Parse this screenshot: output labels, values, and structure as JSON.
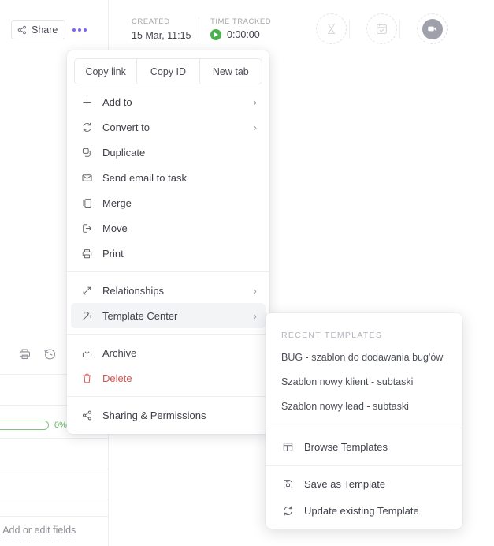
{
  "topbar": {
    "share_label": "Share",
    "share_icon": "share-nodes-icon",
    "more_icon": "ellipsis-icon",
    "created_label": "CREATED",
    "created_value": "15 Mar, 11:15",
    "time_tracked_label": "TIME TRACKED",
    "time_tracked_value": "0:00:00",
    "play_icon": "play-circle-icon",
    "buttons": [
      {
        "name": "hourglass-icon",
        "title": "Track time estimate"
      },
      {
        "name": "calendar-check-icon",
        "title": "Set due date"
      },
      {
        "name": "video-camera-icon",
        "title": "Record clip"
      }
    ]
  },
  "left_panel": {
    "print_icon": "print-icon",
    "history_icon": "history-clock-icon",
    "progress_percent": "0%",
    "progress_value": 0,
    "add_fields_plus": "+",
    "add_fields_label": "Add or edit fields"
  },
  "context_menu": {
    "quick_actions": [
      {
        "label": "Copy link",
        "name": "copy-link-button"
      },
      {
        "label": "Copy ID",
        "name": "copy-id-button"
      },
      {
        "label": "New tab",
        "name": "new-tab-button"
      }
    ],
    "group_one": [
      {
        "label": "Add to",
        "icon": "plus-icon",
        "arrow": "›",
        "name": "menu-item-add-to"
      },
      {
        "label": "Convert to",
        "icon": "convert-arrows-icon",
        "arrow": "›",
        "name": "menu-item-convert-to"
      },
      {
        "label": "Duplicate",
        "icon": "duplicate-icon",
        "arrow": "",
        "name": "menu-item-duplicate"
      },
      {
        "label": "Send email to task",
        "icon": "envelope-icon",
        "arrow": "",
        "name": "menu-item-send-email-to-task"
      },
      {
        "label": "Merge",
        "icon": "merge-icon",
        "arrow": "",
        "name": "menu-item-merge"
      },
      {
        "label": "Move",
        "icon": "move-arrow-icon",
        "arrow": "",
        "name": "menu-item-move"
      },
      {
        "label": "Print",
        "icon": "print-icon",
        "arrow": "",
        "name": "menu-item-print"
      }
    ],
    "group_two": [
      {
        "label": "Relationships",
        "icon": "relationships-icon",
        "arrow": "›",
        "name": "menu-item-relationships",
        "active": false
      },
      {
        "label": "Template Center",
        "icon": "magic-wand-icon",
        "arrow": "›",
        "name": "menu-item-template-center",
        "active": true
      }
    ],
    "group_three": [
      {
        "label": "Archive",
        "icon": "archive-box-icon",
        "arrow": "",
        "name": "menu-item-archive",
        "danger": false
      },
      {
        "label": "Delete",
        "icon": "trash-icon",
        "arrow": "",
        "name": "menu-item-delete",
        "danger": true
      }
    ],
    "group_four": [
      {
        "label": "Sharing & Permissions",
        "icon": "share-nodes-icon",
        "arrow": "",
        "name": "menu-item-sharing-permissions"
      }
    ]
  },
  "submenu": {
    "section_title": "RECENT TEMPLATES",
    "recent_templates": [
      {
        "label": "BUG - szablon do dodawania bug'ów",
        "name": "template-item-bug"
      },
      {
        "label": "Szablon nowy klient - subtaski",
        "name": "template-item-nowy-klient"
      },
      {
        "label": "Szablon nowy lead - subtaski",
        "name": "template-item-nowy-lead"
      }
    ],
    "browse": {
      "label": "Browse Templates",
      "icon": "browse-layout-icon",
      "name": "browse-templates-item"
    },
    "actions": [
      {
        "label": "Save as Template",
        "icon": "save-disk-icon",
        "name": "save-as-template-item"
      },
      {
        "label": "Update existing Template",
        "icon": "refresh-icon",
        "name": "update-existing-template-item"
      }
    ]
  },
  "colors": {
    "accent_purple": "#7b68ee",
    "danger_red": "#d9534f",
    "progress_green": "#7dc47f",
    "play_green": "#4caf50"
  }
}
